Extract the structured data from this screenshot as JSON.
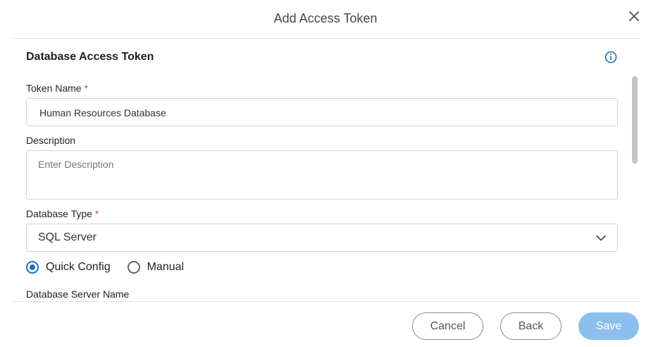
{
  "dialog": {
    "title": "Add Access Token"
  },
  "section": {
    "title": "Database Access Token"
  },
  "fields": {
    "token_name": {
      "label": "Token Name",
      "required_mark": "*",
      "value": "Human Resources Database"
    },
    "description": {
      "label": "Description",
      "placeholder": "Enter Description"
    },
    "database_type": {
      "label": "Database Type",
      "required_mark": "*",
      "selected": "SQL Server"
    }
  },
  "config_mode": {
    "options": [
      {
        "label": "Quick Config",
        "selected": true
      },
      {
        "label": "Manual",
        "selected": false
      }
    ]
  },
  "clipped_label": "Database Server Name",
  "footer": {
    "cancel_label": "Cancel",
    "back_label": "Back",
    "save_label": "Save"
  },
  "colors": {
    "accent": "#1e6fb8",
    "save_disabled": "#8dbfec",
    "required": "#d04a4a"
  },
  "icons": {
    "close": "close-icon",
    "info": "info-icon",
    "dropdown": "chevron-down-icon"
  }
}
